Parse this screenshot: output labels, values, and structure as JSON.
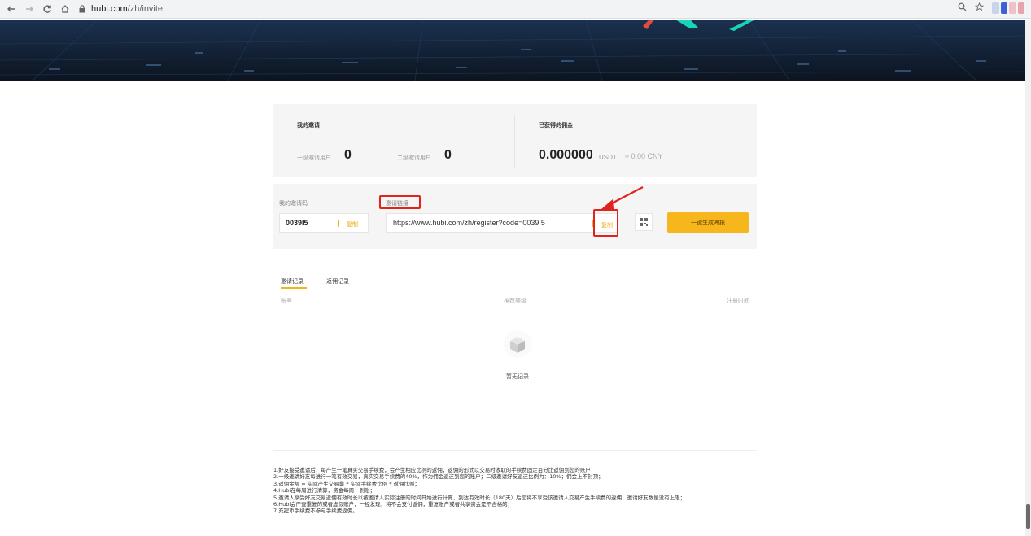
{
  "browser": {
    "url_host": "hubi.com",
    "url_path": "/zh/invite"
  },
  "stats": {
    "my_invites_title": "我的邀请",
    "level1_label": "一级邀请用户",
    "level1_value": "0",
    "level2_label": "二级邀请用户",
    "level2_value": "0",
    "commission_title": "已获得的佣金",
    "commission_value": "0.000000",
    "commission_unit": "USDT",
    "commission_conv": "≈ 0.00 CNY"
  },
  "invite": {
    "code_label": "我的邀请码",
    "code_value": "0039I5",
    "code_copy": "复制",
    "link_label": "邀请链接",
    "link_value": "https://www.hubi.com/zh/register?code=0039I5",
    "link_copy": "复制",
    "poster_button": "一键生成海报"
  },
  "tabs": {
    "records": "邀请记录",
    "rebate": "返佣记录"
  },
  "table": {
    "col_account": "账号",
    "col_level": "推荐等级",
    "col_time": "注册时间",
    "empty_text": "暂无记录"
  },
  "rules": [
    "1.好友接受邀请后，每产生一笔真实交易手续费，会产生相应比例的返佣，返佣的形式以交易时收取的手续费固定百分比返佣到您的账户；",
    "2.一级邀请好友每进行一笔有效交易，真实交易手续费的40%，作为佣金返还到您的账户；二级邀请好友返还比例为：10%；佣金上不封顶；",
    "3.返佣金额 = 实际产生交易量 * 实际手续费比例 * 返佣比例；",
    "4.Hubi在每周进行清算，资金每周一到账；",
    "5.邀请人享受好友交易返佣有效时长以被邀请人实际注册的时间开始进行计算，到达有效时长（180天）后您将不享受该邀请人交易产生手续费的返佣，邀请好友数量没有上限；",
    "6.Hubi会严查重复的或者虚假账户，一经发现，将不会支付返佣，重复账户或者共享资金是不合格的；",
    "7.充提币手续费不参与手续费返佣。"
  ],
  "colors": {
    "accent": "#f7b61c",
    "annotation": "#e0231c",
    "banner_bg": "#13223a"
  }
}
